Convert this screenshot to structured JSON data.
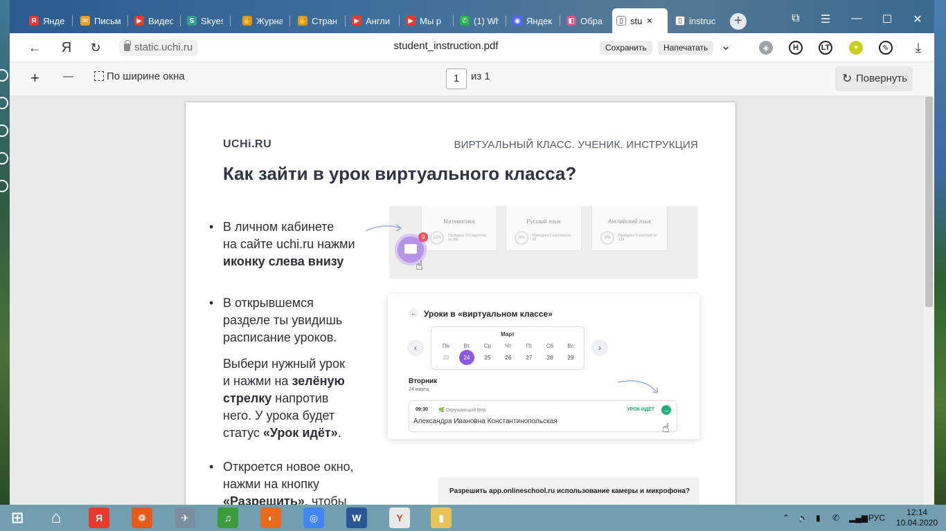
{
  "tabs": [
    {
      "label": "Яндекс",
      "icon": "Я",
      "color": "#e83b2e"
    },
    {
      "label": "Письма",
      "icon": "✉",
      "color": "#e8a22e"
    },
    {
      "label": "Видео",
      "icon": "▶",
      "color": "#e83b2e"
    },
    {
      "label": "Skyes",
      "icon": "S",
      "color": "#34a08c"
    },
    {
      "label": "Журнал",
      "icon": "✋",
      "color": "#d49a2b"
    },
    {
      "label": "Стран",
      "icon": "✋",
      "color": "#d49a2b"
    },
    {
      "label": "Англи",
      "icon": "▶",
      "color": "#e83b2e"
    },
    {
      "label": "Мы р",
      "icon": "▶",
      "color": "#e83b2e"
    },
    {
      "label": "(1) Wh",
      "icon": "✆",
      "color": "#25b34a"
    },
    {
      "label": "Яндек",
      "icon": "◉",
      "color": "#5863f8"
    },
    {
      "label": "Обра",
      "icon": "◧",
      "color": "#d8578a"
    },
    {
      "label": "stu",
      "icon": "▯",
      "color": "#ffffff"
    },
    {
      "label": "instruc",
      "icon": "▯",
      "color": "#ffffff"
    }
  ],
  "window_controls": {
    "tabs": "⧉",
    "menu": "☰",
    "minimize": "—",
    "maximize": "☐",
    "close": "✕"
  },
  "address": {
    "back": "←",
    "ya": "Я",
    "reload": "↻",
    "url": "static.uchi.ru",
    "doc_title": "student_instruction.pdf",
    "save": "Сохранить",
    "print": "Напечатать",
    "more": "⌄",
    "download": "⤓"
  },
  "extensions": [
    {
      "icon": "◈",
      "bg": "#9ea3a8"
    },
    {
      "icon": "H",
      "bg": "#ffffff"
    },
    {
      "icon": "LT",
      "bg": "#ffffff"
    },
    {
      "icon": "+",
      "bg": "#c4cf22"
    },
    {
      "icon": "✎",
      "bg": "#ffffff"
    }
  ],
  "pdf_toolbar": {
    "zoom_in": "+",
    "zoom_out": "—",
    "fit_width": "По ширине окна",
    "page": "1",
    "of": "из 1",
    "rotate": "Повернуть"
  },
  "doc": {
    "logo": "UCHi.RU",
    "header_right": "ВИРТУАЛЬНЫЙ КЛАСС. УЧЕНИК. ИНСТРУКЦИЯ",
    "heading": "Как зайти в урок виртуального класса?",
    "b1_l1": "В личном кабинете",
    "b1_l2": "на сайте uchi.ru нажми",
    "b1_l3": "иконку слева внизу",
    "b2_l1": "В открывшемся",
    "b2_l2": "разделе ты увидишь",
    "b2_l3": "расписание уроков.",
    "p2_l1": "Выбери нужный урок",
    "p2_l2a": "и нажми на ",
    "p2_l2b": "зелёную",
    "p2_l3a": "стрелку",
    "p2_l3b": " напротив",
    "p2_l4": "него. У урока будет",
    "p2_l5a": "статус ",
    "p2_l5b": "«Урок идёт»",
    "p2_l5c": ".",
    "b3_l1": "Откроется новое окно,",
    "b3_l2": "нажми на кнопку",
    "b3_l3a": "«Разрешить»",
    "b3_l3b": ", чтобы"
  },
  "ill1": {
    "cards": [
      {
        "title": "Математика",
        "ring": "11%",
        "stat": "Пройдено 222 карточки из 286"
      },
      {
        "title": "Русский язык",
        "ring": "0%",
        "stat": "Пройдено 0 карточек из 95"
      },
      {
        "title": "Английский язык",
        "ring": "0%",
        "stat": "Пройдено 0 карточек из 124"
      }
    ],
    "badge": "9"
  },
  "ill2": {
    "title": "Уроки в «виртуальном классе»",
    "month": "Март",
    "days": [
      "Пн",
      "Вт",
      "Ср",
      "Чт",
      "Пт",
      "Сб",
      "Вс"
    ],
    "dates": [
      "23",
      "24",
      "25",
      "26",
      "27",
      "28",
      "29"
    ],
    "selected_index": 1,
    "weekday": "Вторник",
    "date": "24 марта",
    "time": "09:30",
    "subject": "Окружающий мир",
    "status": "УРОК ИДЁТ",
    "teacher": "Александра Ивановна Константинопольская"
  },
  "ill3": {
    "question": "Разрешить app.onlineschool.ru использование камеры и микрофона?"
  },
  "taskbar": {
    "apps": [
      "⊞",
      "⌂",
      "Я",
      "❁",
      "✈",
      "♫",
      "◐",
      "◎",
      "W",
      "Y",
      "▮"
    ],
    "lang": "РУС",
    "time": "12:14",
    "date": "10.04.2020"
  }
}
